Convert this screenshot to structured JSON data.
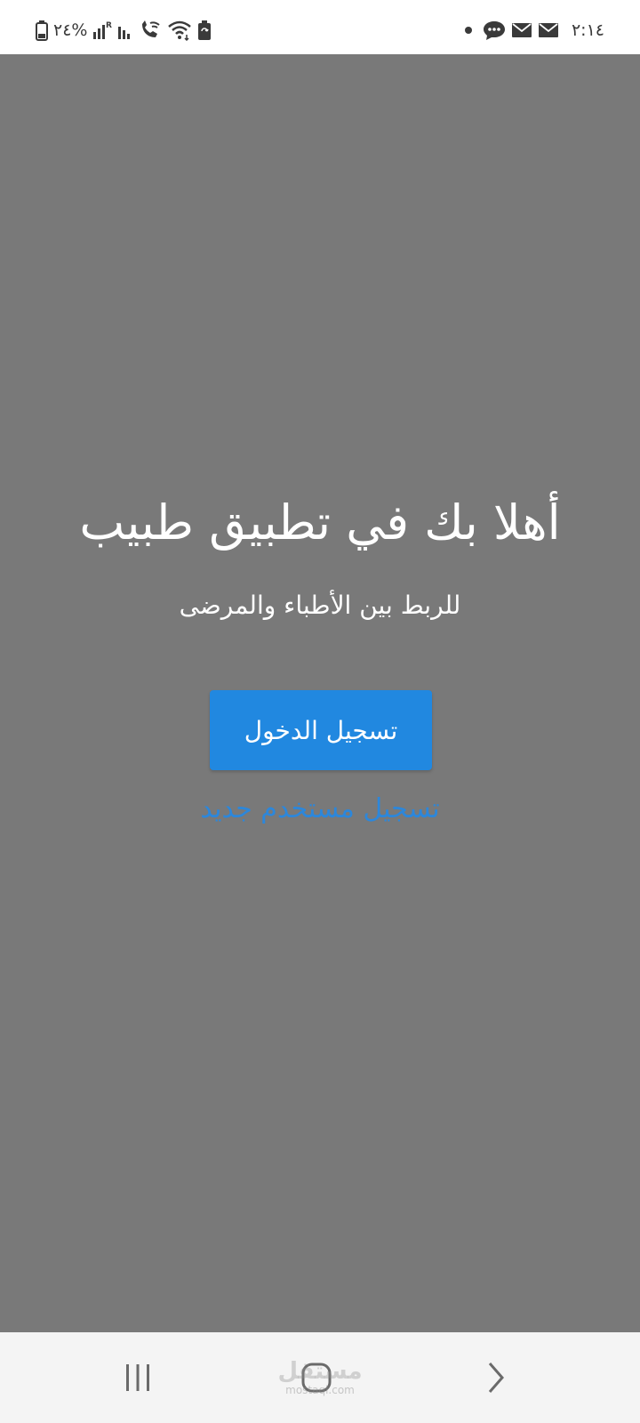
{
  "status_bar": {
    "time": "٢:١٤",
    "battery_percent": "%٢٤",
    "icons_right": [
      "dot-icon",
      "message-bubble-icon",
      "mail-icon",
      "mail-icon"
    ],
    "icons_left": [
      "battery-icon",
      "signal-roaming-icon",
      "signal-icon",
      "wifi-calling-icon",
      "wifi-icon",
      "battery-saver-icon"
    ]
  },
  "main": {
    "title": "أهلا بك في تطبيق طبيب",
    "subtitle": "للربط بين الأطباء والمرضى",
    "login_label": "تسجيل الدخول",
    "register_label": "تسجيل مستخدم جديد",
    "background_color": "#797979",
    "accent_color": "#2188e0",
    "link_color": "#2c87db"
  },
  "nav_bar": {
    "buttons": [
      "recents-icon",
      "home-icon",
      "back-icon"
    ]
  },
  "watermark": {
    "logo_text": "مستقل",
    "url": "mostaql.com"
  }
}
